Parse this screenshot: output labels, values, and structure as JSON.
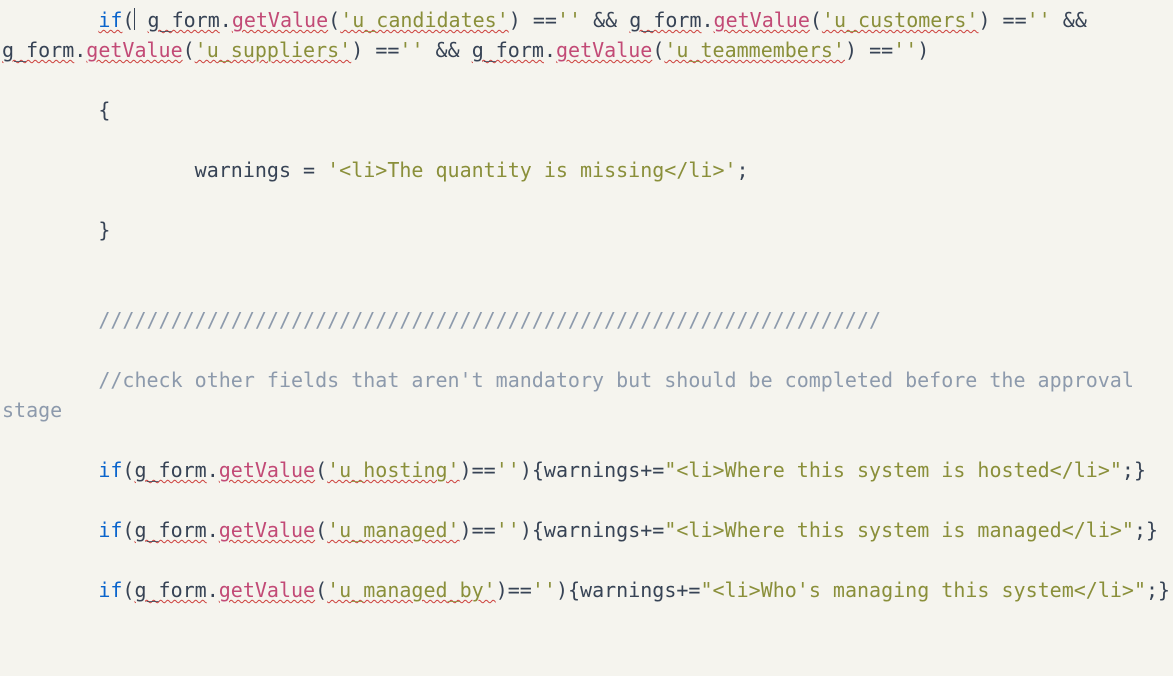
{
  "code": {
    "kw_if": "if",
    "g_form": "g_form",
    "getValue": "getValue",
    "s_candidates": "'u_candidates'",
    "s_customers": "'u_customers'",
    "s_suppliers": "'u_suppliers'",
    "s_teammembers": "'u_teammembers'",
    "s_hosting": "'u_hosting'",
    "s_managed": "'u_managed'",
    "s_managed_by": "'u_managed_by'",
    "empty": "''",
    "amp": "&&",
    "brace_open": "{",
    "brace_close": "}",
    "warnings": "warnings",
    "assign": "=",
    "plus_eq": "+=",
    "semi": ";",
    "eq_eq": "==",
    "paren_open": "(",
    "paren_close": ")",
    "dot": ".",
    "str_quantity": "'<li>The quantity is missing</li>'",
    "comm_slash": "/////////////////////////////////////////////////////////////////",
    "comm_text": "//check other fields that aren't mandatory but should be completed before the approval stage",
    "str_hosted": "\"<li>Where this system is hosted</li>\"",
    "str_managed": "\"<li>Where this system is managed</li>\"",
    "str_managed_by": "\"<li>Who's managing this system</li>\""
  }
}
